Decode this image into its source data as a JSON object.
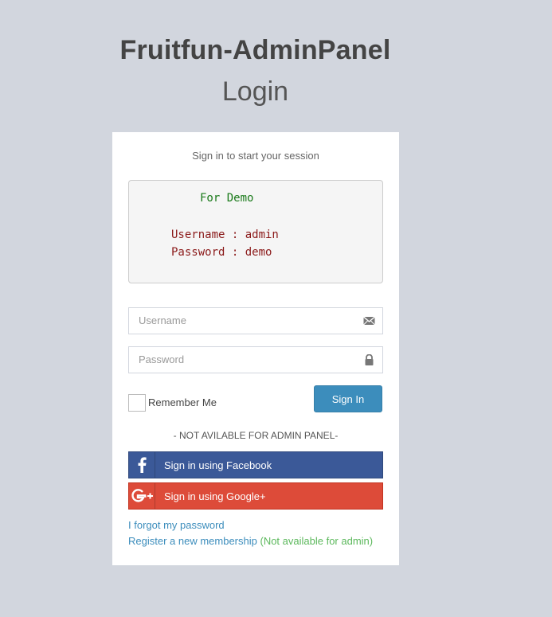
{
  "header": {
    "title": "Fruitfun-AdminPanel",
    "subtitle": "Login"
  },
  "login": {
    "box_message": "Sign in to start your session",
    "demo": {
      "title": "For Demo",
      "username_line": "Username : admin",
      "password_line": "Password : demo"
    },
    "username_placeholder": "Username",
    "password_placeholder": "Password",
    "remember_label": "Remember Me",
    "signin_label": "Sign In",
    "not_available": "- NOT AVILABLE FOR ADMIN PANEL-",
    "facebook_label": "Sign in using Facebook",
    "google_label": "Sign in using Google+",
    "forgot_link": "I forgot my password",
    "register_link": "Register a new membership",
    "register_note": "(Not available for admin)"
  },
  "icons": {
    "username_field": "envelope-icon",
    "password_field": "lock-icon",
    "facebook": "facebook-icon",
    "google": "google-plus-icon"
  },
  "colors": {
    "background": "#d2d6de",
    "primary": "#3c8dbc",
    "facebook": "#3b5998",
    "google": "#dd4b39",
    "demo_title": "#1a7a1a",
    "demo_text": "#8b1a1a",
    "note": "#5cb85c"
  }
}
